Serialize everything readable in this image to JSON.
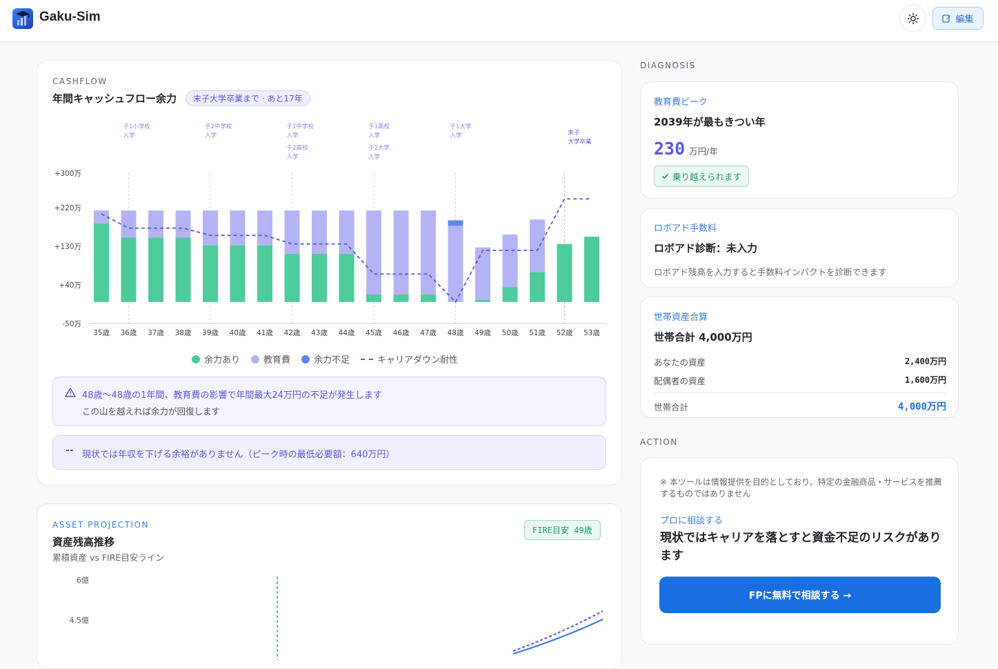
{
  "app": {
    "title": "Gaku-Sim",
    "edit_label": "編集"
  },
  "cashflow": {
    "eyebrow": "CASHFLOW",
    "title": "年間キャッシュフロー余力",
    "badge": "末子大学卒業まで · あと17年",
    "legend": [
      "余力あり",
      "教育費",
      "余力不足",
      "キャリアダウン耐性"
    ],
    "alert1_main": "48歳〜48歳の1年間、教育費の影響で年間最大24万円の不足が発生します",
    "alert1_sub": "この山を越えれば余力が回復します",
    "alert2_icon": "--",
    "alert2": "現状では年収を下げる余裕がありません（ピーク時の最低必要額：640万円）"
  },
  "chart_data": {
    "type": "bar",
    "categories": [
      "35歳",
      "36歳",
      "37歳",
      "38歳",
      "39歳",
      "40歳",
      "41歳",
      "42歳",
      "43歳",
      "44歳",
      "45歳",
      "46歳",
      "47歳",
      "48歳",
      "49歳",
      "50歳",
      "51歳",
      "52歳",
      "53歳"
    ],
    "series": [
      {
        "name": "余力あり",
        "values": [
          183,
          150,
          150,
          150,
          132,
          132,
          132,
          112,
          112,
          112,
          18,
          18,
          18,
          0,
          5,
          35,
          70,
          135,
          152
        ]
      },
      {
        "name": "教育費",
        "values": [
          30,
          63,
          63,
          63,
          81,
          81,
          81,
          101,
          101,
          101,
          195,
          195,
          195,
          190,
          122,
          122,
          122,
          0,
          0
        ]
      },
      {
        "name": "余力不足",
        "values": [
          0,
          0,
          0,
          0,
          0,
          0,
          0,
          0,
          0,
          0,
          0,
          0,
          0,
          24,
          0,
          0,
          0,
          0,
          0
        ]
      },
      {
        "name": "キャリアダウン耐性",
        "values": [
          205,
          172,
          172,
          172,
          155,
          155,
          155,
          135,
          135,
          135,
          65,
          65,
          65,
          0,
          120,
          120,
          120,
          240,
          240
        ]
      }
    ],
    "ytick_labels": [
      "+300万",
      "+220万",
      "+130万",
      "+40万",
      "-50万"
    ],
    "ylim": [
      -50,
      300
    ],
    "events": [
      {
        "age": "36歳",
        "lines": [
          "子1小学校",
          "入学"
        ]
      },
      {
        "age": "39歳",
        "lines": [
          "子2中学校",
          "入学"
        ]
      },
      {
        "age": "42歳",
        "lines": [
          "子1中学校",
          "入学",
          "子2高校",
          "入学"
        ]
      },
      {
        "age": "45歳",
        "lines": [
          "子1高校",
          "入学",
          "子2大学",
          "入学"
        ]
      },
      {
        "age": "48歳",
        "lines": [
          "子1大学",
          "入学"
        ]
      },
      {
        "age": "52歳",
        "lines": [
          "末子",
          "大学卒業"
        ]
      }
    ],
    "colors": {
      "surplus": "#4ecb9b",
      "education": "#b4b4f5",
      "deficit": "#5b87e6",
      "career": "#5a55d6"
    }
  },
  "asset": {
    "eyebrow": "ASSET PROJECTION",
    "title": "資産残高推移",
    "subtitle": "累積資産 vs FIRE目安ライン",
    "fire_badge": "FIRE目安 49歳",
    "ytick_labels": [
      "6億",
      "4.5億"
    ]
  },
  "diagnosis": {
    "label": "DIAGNOSIS",
    "peak": {
      "eyebrow": "教育費ピーク",
      "title": "2039年が最もきつい年",
      "value": "230",
      "unit": "万円/年",
      "status": "乗り越えられます"
    },
    "robo": {
      "eyebrow": "ロボアド手数料",
      "title": "ロボアド診断：未入力",
      "desc": "ロボアド残高を入力すると手数料インパクトを診断できます"
    },
    "assets": {
      "eyebrow": "世帯資産合算",
      "title": "世帯合計 4,000万円",
      "rows": [
        {
          "label": "あなたの資産",
          "value": "2,400万円"
        },
        {
          "label": "配偶者の資産",
          "value": "1,600万円"
        }
      ],
      "total_label": "世帯合計",
      "total_value": "4,000万円"
    }
  },
  "action": {
    "label": "ACTION",
    "disclaimer": "※ 本ツールは情報提供を目的としており、特定の金融商品・サービスを推薦するものではありません",
    "eyebrow": "プロに相談する",
    "title": "現状ではキャリアを落とすと資金不足のリスクがあります",
    "cta": "FPに無料で相談する →"
  }
}
